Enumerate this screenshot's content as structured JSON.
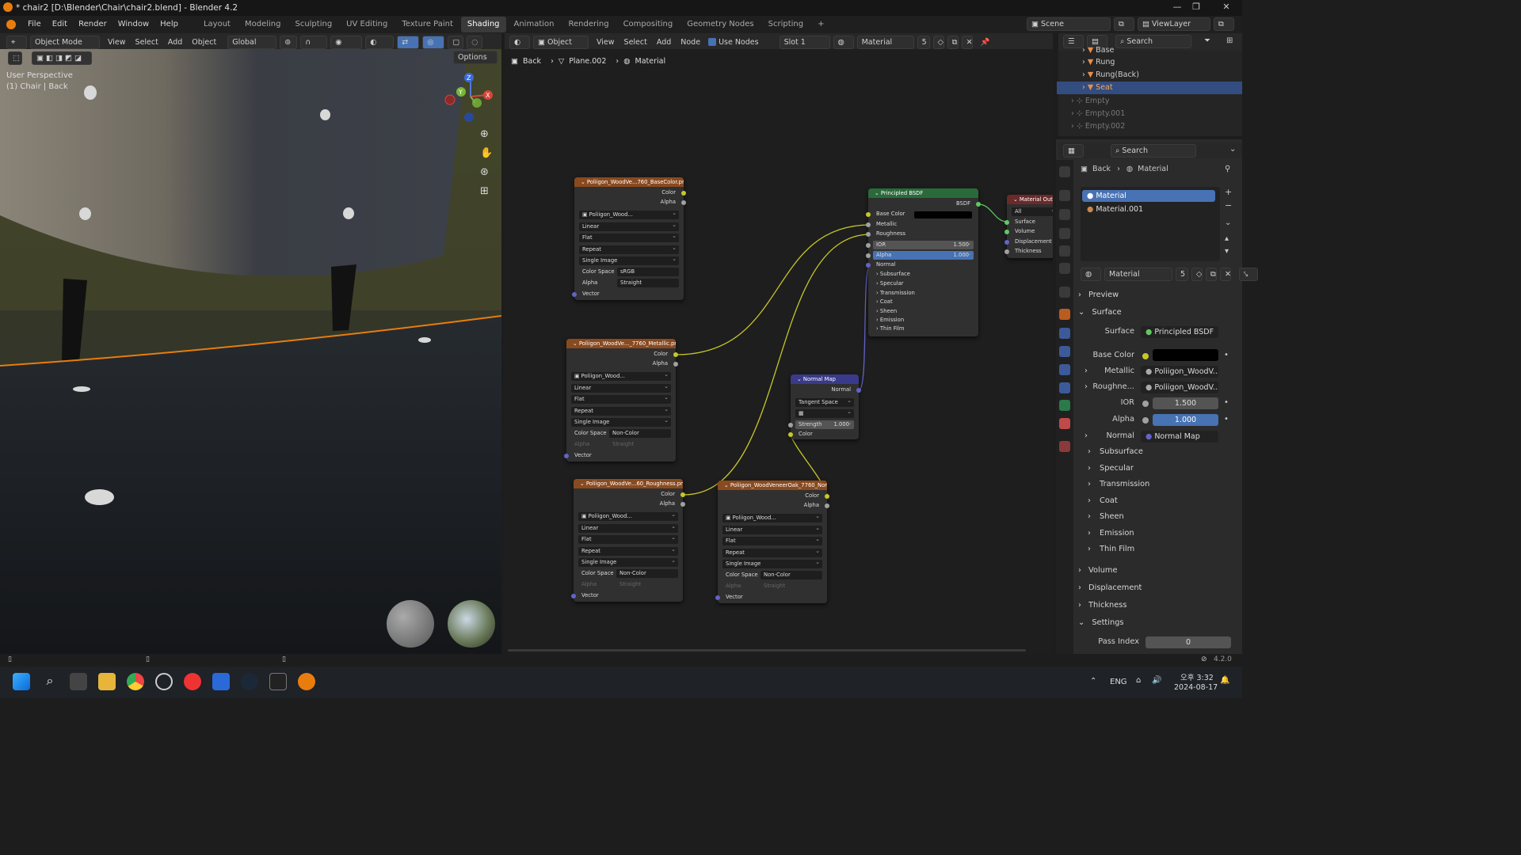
{
  "window": {
    "title": "* chair2 [D:\\Blender\\Chair\\chair2.blend] - Blender 4.2"
  },
  "menu": [
    "File",
    "Edit",
    "Render",
    "Window",
    "Help"
  ],
  "workspaces": [
    "Layout",
    "Modeling",
    "Sculpting",
    "UV Editing",
    "Texture Paint",
    "Shading",
    "Animation",
    "Rendering",
    "Compositing",
    "Geometry Nodes",
    "Scripting"
  ],
  "active_workspace": "Shading",
  "scene": "Scene",
  "view_layer": "ViewLayer",
  "viewport": {
    "mode": "Object Mode",
    "menus": [
      "View",
      "Select",
      "Add",
      "Object"
    ],
    "orientation": "Global",
    "options": "Options",
    "perspective": "User Perspective",
    "object_info": "(1) Chair | Back"
  },
  "node_header": {
    "type": "Object",
    "menus": [
      "View",
      "Select",
      "Add",
      "Node"
    ],
    "use_nodes": "Use Nodes",
    "slot": "Slot 1",
    "material": "Material",
    "users": "5",
    "search": "Search"
  },
  "breadcrumb": [
    "Back",
    "Plane.002",
    "Material"
  ],
  "nodes": {
    "basecolor": {
      "title": "Poliigon_WoodVe...760_BaseColor.png",
      "file": "Poliigon_Wood...",
      "interp": "Linear",
      "proj": "Flat",
      "ext": "Repeat",
      "src": "Single Image",
      "cs_label": "Color Space",
      "cs": "sRGB",
      "alpha_label": "Alpha",
      "alpha": "Straight",
      "out1": "Color",
      "out2": "Alpha",
      "in": "Vector"
    },
    "metallic": {
      "title": "Poliigon_WoodVe..._7760_Metallic.png",
      "file": "Poliigon_Wood...",
      "interp": "Linear",
      "proj": "Flat",
      "ext": "Repeat",
      "src": "Single Image",
      "cs_label": "Color Space",
      "cs": "Non-Color",
      "alpha_label": "Alpha",
      "alpha": "Straight",
      "out1": "Color",
      "out2": "Alpha",
      "in": "Vector"
    },
    "roughness": {
      "title": "Poliigon_WoodVe...60_Roughness.png",
      "file": "Poliigon_Wood...",
      "interp": "Linear",
      "proj": "Flat",
      "ext": "Repeat",
      "src": "Single Image",
      "cs_label": "Color Space",
      "cs": "Non-Color",
      "alpha_label": "Alpha",
      "alpha": "Straight",
      "out1": "Color",
      "out2": "Alpha",
      "in": "Vector"
    },
    "normaltex": {
      "title": "Poliigon_WoodVeneerOak_7760_Nor...",
      "file": "Poliigon_Wood...",
      "interp": "Linear",
      "proj": "Flat",
      "ext": "Repeat",
      "src": "Single Image",
      "cs_label": "Color Space",
      "cs": "Non-Color",
      "alpha_label": "Alpha",
      "alpha": "Straight",
      "out1": "Color",
      "out2": "Alpha",
      "in": "Vector"
    },
    "normalmap": {
      "title": "Normal Map",
      "out": "Normal",
      "space": "Tangent Space",
      "strength_label": "Strength",
      "strength": "1.000",
      "in": "Color"
    },
    "bsdf": {
      "title": "Principled BSDF",
      "out": "BSDF",
      "base": "Base Color",
      "metallic": "Metallic",
      "roughness": "Roughness",
      "ior_label": "IOR",
      "ior": "1.500",
      "alpha_label": "Alpha",
      "alpha": "1.000",
      "normal": "Normal",
      "panels": [
        "Subsurface",
        "Specular",
        "Transmission",
        "Coat",
        "Sheen",
        "Emission",
        "Thin Film"
      ]
    },
    "output": {
      "title": "Material Output",
      "target": "All",
      "inputs": [
        "Surface",
        "Volume",
        "Displacement",
        "Thickness"
      ]
    }
  },
  "outliner": [
    {
      "name": "Base",
      "dim": false
    },
    {
      "name": "Rung",
      "dim": false
    },
    {
      "name": "Rung(Back)",
      "dim": false
    },
    {
      "name": "Seat",
      "dim": false,
      "active": true
    },
    {
      "name": "Empty",
      "dim": true
    },
    {
      "name": "Empty.001",
      "dim": true
    },
    {
      "name": "Empty.002",
      "dim": true
    }
  ],
  "properties": {
    "search": "Search",
    "breadcrumb": [
      "Back",
      "Material"
    ],
    "slots": [
      "Material",
      "Material.001"
    ],
    "material": "Material",
    "users": "5",
    "preview": "Preview",
    "surface_panel": "Surface",
    "surface_label": "Surface",
    "surface": "Principled BSDF",
    "base_color_label": "Base Color",
    "metallic_label": "Metallic",
    "metallic": "Poliigon_WoodV...",
    "roughness_label": "Roughne...",
    "roughness": "Poliigon_WoodV...",
    "ior_label": "IOR",
    "ior": "1.500",
    "alpha_label": "Alpha",
    "alpha": "1.000",
    "normal_label": "Normal",
    "normal": "Normal Map",
    "subpanels": [
      "Subsurface",
      "Specular",
      "Transmission",
      "Coat",
      "Sheen",
      "Emission",
      "Thin Film"
    ],
    "volume": "Volume",
    "displacement": "Displacement",
    "thickness": "Thickness",
    "settings": "Settings",
    "pass_label": "Pass Index",
    "pass": "0"
  },
  "status": {
    "version": "4.2.0"
  },
  "taskbar": {
    "lang": "ENG",
    "time": "오후 3:32",
    "date": "2024-08-17"
  },
  "colors": {
    "accent": "#4772b3",
    "image_header": "#8a4a1f",
    "shader_header": "#2a6a3a",
    "vector_header": "#3a3a8a",
    "output_header": "#6a2a2a",
    "selection": "#e87d0d"
  }
}
